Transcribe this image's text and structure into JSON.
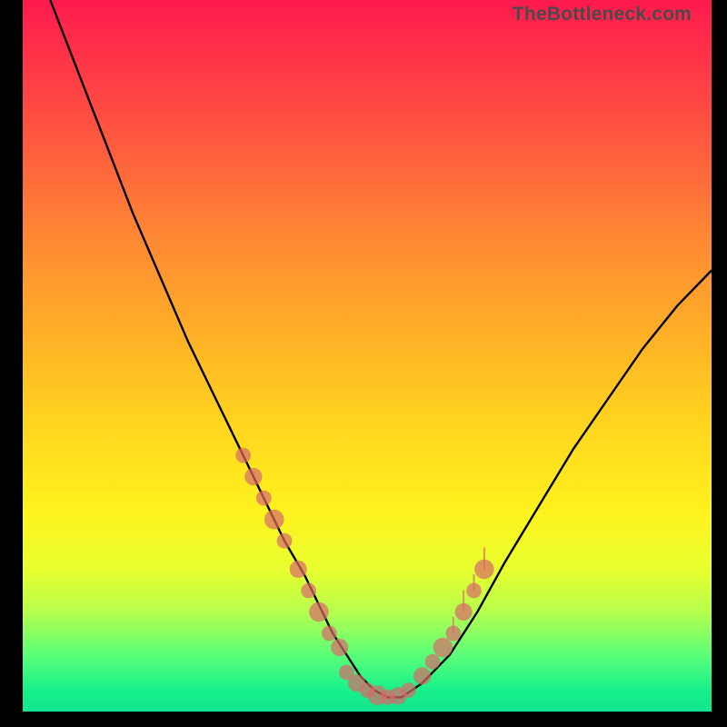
{
  "watermark": "TheBottleneck.com",
  "chart_data": {
    "type": "line",
    "title": "",
    "xlabel": "",
    "ylabel": "",
    "xlim": [
      0,
      100
    ],
    "ylim": [
      0,
      100
    ],
    "series": [
      {
        "name": "bottleneck-curve",
        "x": [
          4,
          8,
          12,
          16,
          20,
          24,
          28,
          32,
          35,
          38,
          41,
          43,
          45,
          47,
          49,
          51,
          53,
          55,
          58,
          62,
          66,
          70,
          75,
          80,
          85,
          90,
          95,
          100
        ],
        "y": [
          100,
          90,
          80,
          70,
          61,
          52,
          44,
          36,
          30,
          24,
          19,
          15,
          11,
          8,
          5,
          3,
          2,
          2,
          4,
          8,
          14,
          21,
          29,
          37,
          44,
          51,
          57,
          62
        ]
      }
    ],
    "markers_left": [
      {
        "x": 32,
        "y": 36,
        "r": 1.4
      },
      {
        "x": 33.5,
        "y": 33,
        "r": 1.6
      },
      {
        "x": 35,
        "y": 30,
        "r": 1.4
      },
      {
        "x": 36.5,
        "y": 27,
        "r": 1.8
      },
      {
        "x": 38,
        "y": 24,
        "r": 1.4
      },
      {
        "x": 40,
        "y": 20,
        "r": 1.6
      },
      {
        "x": 41.5,
        "y": 17,
        "r": 1.4
      },
      {
        "x": 43,
        "y": 14,
        "r": 1.8
      },
      {
        "x": 44.5,
        "y": 11,
        "r": 1.4
      },
      {
        "x": 46,
        "y": 9,
        "r": 1.6
      }
    ],
    "markers_floor": [
      {
        "x": 47,
        "y": 5.5,
        "r": 1.4
      },
      {
        "x": 48.5,
        "y": 4,
        "r": 1.6
      },
      {
        "x": 50,
        "y": 3,
        "r": 1.4
      },
      {
        "x": 51.5,
        "y": 2.3,
        "r": 1.8
      },
      {
        "x": 53,
        "y": 2,
        "r": 1.4
      },
      {
        "x": 54.5,
        "y": 2.2,
        "r": 1.6
      },
      {
        "x": 56,
        "y": 3,
        "r": 1.4
      }
    ],
    "markers_right": [
      {
        "x": 58,
        "y": 5,
        "r": 1.6
      },
      {
        "x": 59.5,
        "y": 7,
        "r": 1.4
      },
      {
        "x": 61,
        "y": 9,
        "r": 1.8
      },
      {
        "x": 62.5,
        "y": 11,
        "r": 1.4
      },
      {
        "x": 64,
        "y": 14,
        "r": 1.6
      },
      {
        "x": 65.5,
        "y": 17,
        "r": 1.4
      },
      {
        "x": 67,
        "y": 20,
        "r": 1.8
      }
    ],
    "spikes_right": [
      {
        "x": 62.5,
        "y": 11,
        "h": 3
      },
      {
        "x": 64,
        "y": 14,
        "h": 4
      },
      {
        "x": 65.5,
        "y": 17,
        "h": 3
      },
      {
        "x": 67,
        "y": 20,
        "h": 4
      }
    ]
  }
}
